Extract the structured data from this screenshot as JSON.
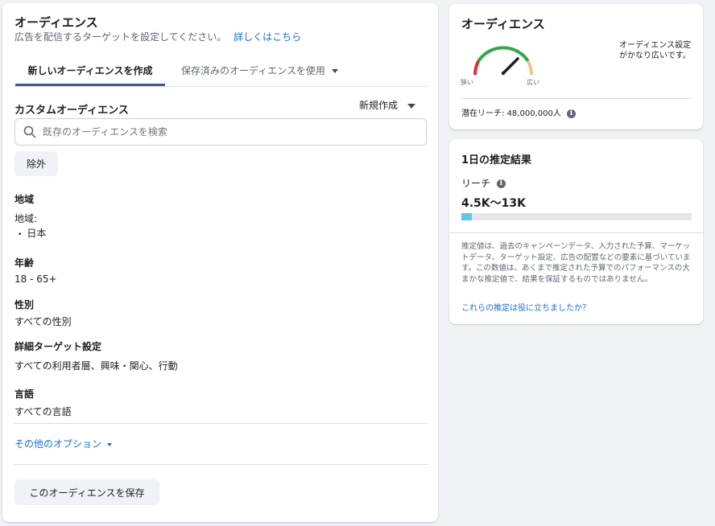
{
  "audience": {
    "title": "オーディエンス",
    "subtitle": "広告を配信するターゲットを設定してください。",
    "learn_more": "詳しくはこちら",
    "tabs": [
      {
        "label": "新しいオーディエンスを作成"
      },
      {
        "label": "保存済みのオーディエンスを使用"
      }
    ],
    "custom_audience_label": "カスタムオーディエンス",
    "create_new_label": "新規作成",
    "search_placeholder": "既存のオーディエンスを検索",
    "exclude_label": "除外",
    "location": {
      "label": "地域",
      "sub_label": "地域:",
      "items": [
        "日本"
      ]
    },
    "age": {
      "label": "年齢",
      "value": "18 - 65+"
    },
    "gender": {
      "label": "性別",
      "value": "すべての性別"
    },
    "detailed_targeting": {
      "label": "詳細ターゲット設定",
      "value": "すべての利用者層、興味・関心、行動"
    },
    "languages": {
      "label": "言語",
      "value": "すべての言語"
    },
    "more_options": "その他のオプション",
    "save_button": "このオーディエンスを保存"
  },
  "audience_definition": {
    "title": "オーディエンス",
    "gauge": {
      "narrow_label": "狭い",
      "broad_label": "広い"
    },
    "description": "オーディエンス設定がかなり広いです。",
    "potential_reach_label": "潜在リーチ:",
    "potential_reach_value": "48,000,000人"
  },
  "daily_results": {
    "title": "1日の推定結果",
    "reach_label": "リーチ",
    "reach_range": "4.5K〜13K",
    "reach_fill_fraction": 0.045,
    "disclaimer": "推定値は、過去のキャンペーンデータ、入力された予算、マーケットデータ、ターゲット設定、広告の配置などの要素に基づいています。この数値は、あくまで推定された予算でのパフォーマンスの大まかな推定値で、結果を保証するものではありません。",
    "feedback_link": "これらの推定は役に立ちましたか？"
  },
  "colors": {
    "tab_underline": "#3b5998",
    "link": "#1a6ed8",
    "gauge_red": "#e02d2d",
    "gauge_green": "#2ea84a",
    "gauge_orange": "#f4c28c",
    "reach_bar": "#5cc8ec"
  }
}
